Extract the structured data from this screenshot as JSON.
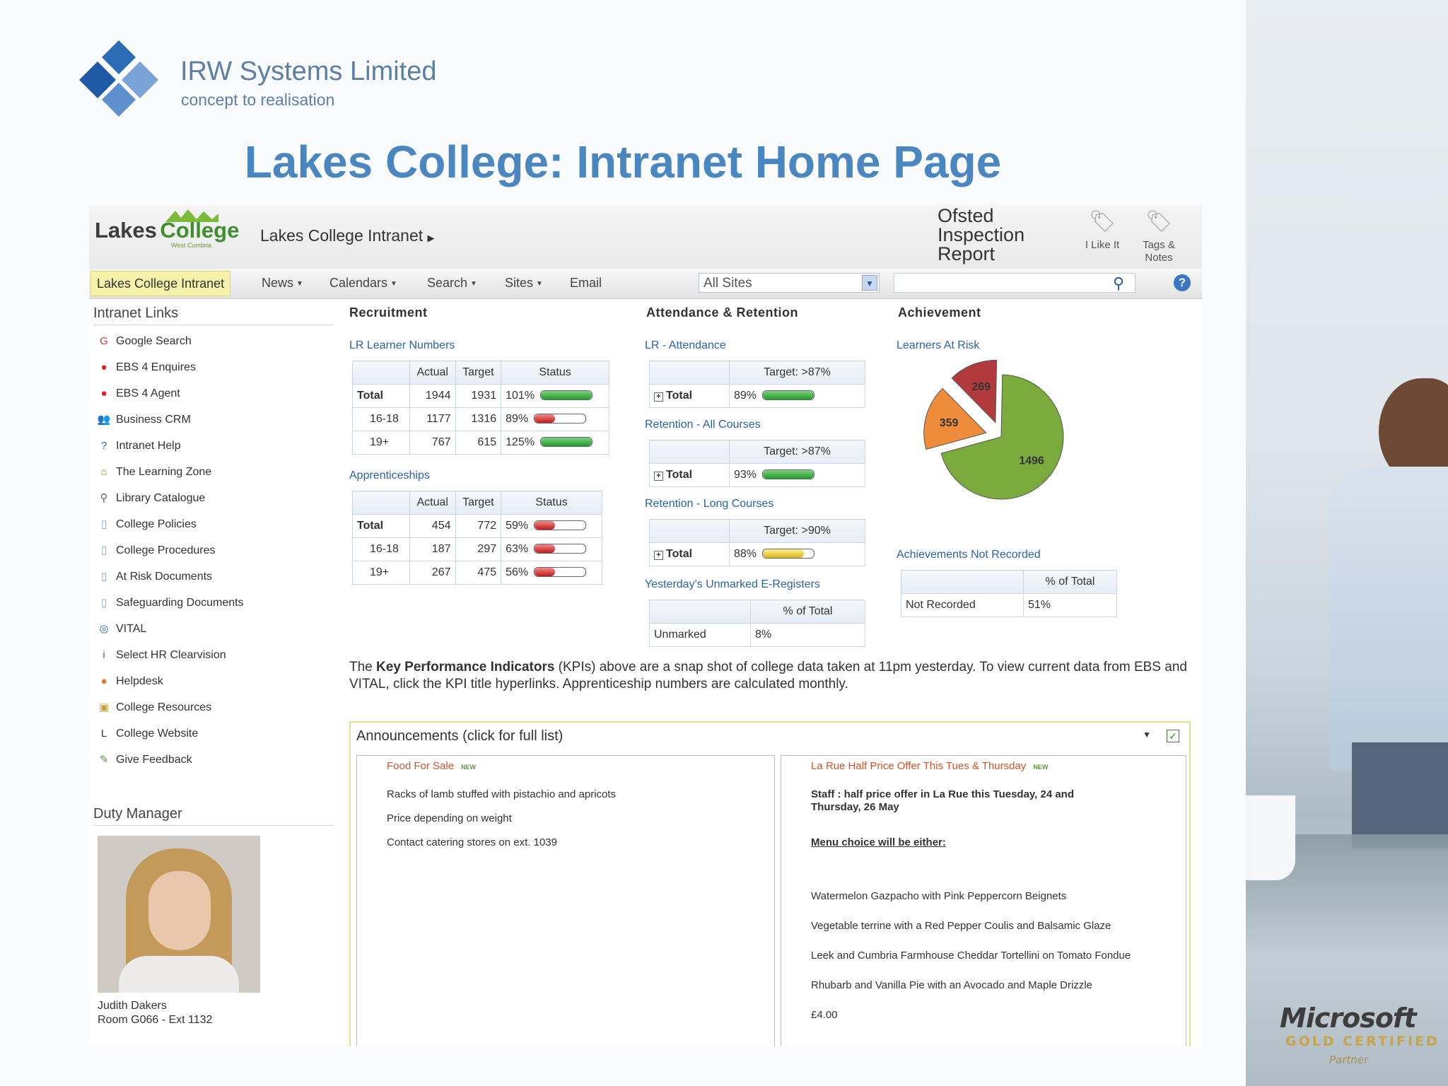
{
  "slide": {
    "company_name": "IRW Systems Limited",
    "tagline": "concept to realisation",
    "title": "Lakes College: Intranet Home Page",
    "partner_logo": "Microsoft",
    "partner_level": "GOLD CERTIFIED",
    "partner_sub": "Partner"
  },
  "header": {
    "logo_text_1": "Lakes",
    "logo_text_2": "College",
    "logo_sub": "West Cumbria",
    "site_title": "Lakes College Intranet",
    "ofsted_line1": "Ofsted",
    "ofsted_line2": "Inspection",
    "ofsted_line3": "Report",
    "i_like_it": "I Like It",
    "tags_notes_1": "Tags &",
    "tags_notes_2": "Notes"
  },
  "nav": {
    "home": "Lakes College Intranet",
    "items": [
      "News",
      "Calendars",
      "Search",
      "Sites",
      "Email"
    ],
    "scope": "All Sites"
  },
  "sidebar": {
    "links_heading": "Intranet Links",
    "links": [
      {
        "label": "Google Search",
        "icon": "google-icon"
      },
      {
        "label": "EBS 4 Enquires",
        "icon": "ebs-icon"
      },
      {
        "label": "EBS 4 Agent",
        "icon": "ebs-icon"
      },
      {
        "label": "Business CRM",
        "icon": "people-icon"
      },
      {
        "label": "Intranet Help",
        "icon": "help-icon"
      },
      {
        "label": "The Learning Zone",
        "icon": "learning-zone-icon"
      },
      {
        "label": "Library Catalogue",
        "icon": "magnifier-icon"
      },
      {
        "label": "College Policies",
        "icon": "document-icon"
      },
      {
        "label": "College Procedures",
        "icon": "document-icon"
      },
      {
        "label": "At Risk Documents",
        "icon": "document-icon"
      },
      {
        "label": "Safeguarding Documents",
        "icon": "document-icon"
      },
      {
        "label": "VITAL",
        "icon": "vital-icon"
      },
      {
        "label": "Select HR Clearvision",
        "icon": "info-icon"
      },
      {
        "label": "Helpdesk",
        "icon": "helpdesk-icon"
      },
      {
        "label": "College Resources",
        "icon": "resources-icon"
      },
      {
        "label": "College Website",
        "icon": "website-icon"
      },
      {
        "label": "Give Feedback",
        "icon": "feedback-icon"
      }
    ],
    "duty_heading": "Duty Manager",
    "duty_name": "Judith Dakers",
    "duty_room": "Room G066 - Ext 1132"
  },
  "recruitment": {
    "heading": "Recruitment",
    "lr_link": "LR Learner Numbers",
    "lr_headers": [
      "",
      "Actual",
      "Target",
      "Status"
    ],
    "lr_rows": [
      {
        "label": "Total",
        "actual": "1944",
        "target": "1931",
        "pct": "101%",
        "fill": 1.0,
        "color": "green"
      },
      {
        "label": "16-18",
        "actual": "1177",
        "target": "1316",
        "pct": "89%",
        "fill": 0.4,
        "color": "red"
      },
      {
        "label": "19+",
        "actual": "767",
        "target": "615",
        "pct": "125%",
        "fill": 1.0,
        "color": "green"
      }
    ],
    "app_link": "Apprenticeships",
    "app_headers": [
      "",
      "Actual",
      "Target",
      "Status"
    ],
    "app_rows": [
      {
        "label": "Total",
        "actual": "454",
        "target": "772",
        "pct": "59%",
        "fill": 0.4,
        "color": "red"
      },
      {
        "label": "16-18",
        "actual": "187",
        "target": "297",
        "pct": "63%",
        "fill": 0.4,
        "color": "red"
      },
      {
        "label": "19+",
        "actual": "267",
        "target": "475",
        "pct": "56%",
        "fill": 0.4,
        "color": "red"
      }
    ]
  },
  "attendance": {
    "heading": "Attendance & Retention",
    "blocks": [
      {
        "link": "LR - Attendance",
        "target": "Target: >87%",
        "label": "Total",
        "pct": "89%",
        "fill": 1.0,
        "color": "green"
      },
      {
        "link": "Retention - All Courses",
        "target": "Target: >87%",
        "label": "Total",
        "pct": "93%",
        "fill": 1.0,
        "color": "green"
      },
      {
        "link": "Retention - Long Courses",
        "target": "Target: >90%",
        "label": "Total",
        "pct": "88%",
        "fill": 0.8,
        "color": "yellow"
      }
    ],
    "ereg_link": "Yesterday's Unmarked E-Registers",
    "ereg_header": "% of Total",
    "ereg_label": "Unmarked",
    "ereg_value": "8%"
  },
  "achievement": {
    "heading": "Achievement",
    "risk_link": "Learners At Risk",
    "not_recorded_link": "Achievements Not Recorded",
    "nr_header": "% of Total",
    "nr_label": "Not Recorded",
    "nr_value": "51%"
  },
  "chart_data": {
    "type": "pie",
    "title": "",
    "values": [
      1496,
      359,
      269
    ],
    "labels": [
      "1496",
      "359",
      "269"
    ],
    "colors": [
      "#7bab3c",
      "#ee8c3c",
      "#b23a3a"
    ]
  },
  "kpi_text": {
    "prefix": "The ",
    "bold": "Key Performance Indicators",
    "rest": " (KPIs) above are a snap shot of college data taken at 11pm yesterday.  To view current data from EBS and VITAL, click the KPI title hyperlinks. Apprenticeship numbers are calculated monthly."
  },
  "announcements": {
    "heading": "Announcements (click for full list)",
    "new_label": "NEW",
    "left": {
      "title": "Food For Sale",
      "lines": [
        "Racks of lamb stuffed with pistachio and apricots",
        "Price depending on weight",
        "Contact catering stores on ext. 1039"
      ]
    },
    "right": {
      "title": "La Rue Half Price Offer This Tues & Thursday",
      "headline_1": "Staff : half price offer in La Rue this Tuesday, 24 and",
      "headline_2": "Thursday, 26 May",
      "menu_heading": "Menu choice will be either:",
      "items": [
        "Watermelon Gazpacho with Pink Peppercorn Beignets",
        "Vegetable terrine with a Red Pepper Coulis and Balsamic Glaze",
        "Leek and Cumbria Farmhouse Cheddar Tortellini on Tomato Fondue",
        "Rhubarb and Vanilla Pie with an Avocado and Maple Drizzle"
      ],
      "price": "£4.00"
    }
  }
}
